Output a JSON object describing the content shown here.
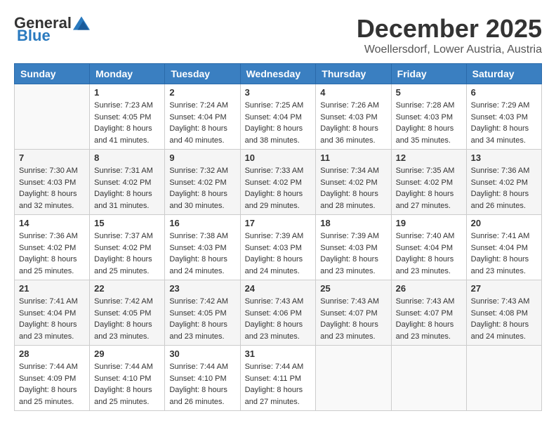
{
  "logo": {
    "general": "General",
    "blue": "Blue"
  },
  "title": "December 2025",
  "location": "Woellersdorf, Lower Austria, Austria",
  "days_of_week": [
    "Sunday",
    "Monday",
    "Tuesday",
    "Wednesday",
    "Thursday",
    "Friday",
    "Saturday"
  ],
  "weeks": [
    [
      {
        "day": "",
        "sunrise": "",
        "sunset": "",
        "daylight": ""
      },
      {
        "day": "1",
        "sunrise": "Sunrise: 7:23 AM",
        "sunset": "Sunset: 4:05 PM",
        "daylight": "Daylight: 8 hours and 41 minutes."
      },
      {
        "day": "2",
        "sunrise": "Sunrise: 7:24 AM",
        "sunset": "Sunset: 4:04 PM",
        "daylight": "Daylight: 8 hours and 40 minutes."
      },
      {
        "day": "3",
        "sunrise": "Sunrise: 7:25 AM",
        "sunset": "Sunset: 4:04 PM",
        "daylight": "Daylight: 8 hours and 38 minutes."
      },
      {
        "day": "4",
        "sunrise": "Sunrise: 7:26 AM",
        "sunset": "Sunset: 4:03 PM",
        "daylight": "Daylight: 8 hours and 36 minutes."
      },
      {
        "day": "5",
        "sunrise": "Sunrise: 7:28 AM",
        "sunset": "Sunset: 4:03 PM",
        "daylight": "Daylight: 8 hours and 35 minutes."
      },
      {
        "day": "6",
        "sunrise": "Sunrise: 7:29 AM",
        "sunset": "Sunset: 4:03 PM",
        "daylight": "Daylight: 8 hours and 34 minutes."
      }
    ],
    [
      {
        "day": "7",
        "sunrise": "Sunrise: 7:30 AM",
        "sunset": "Sunset: 4:03 PM",
        "daylight": "Daylight: 8 hours and 32 minutes."
      },
      {
        "day": "8",
        "sunrise": "Sunrise: 7:31 AM",
        "sunset": "Sunset: 4:02 PM",
        "daylight": "Daylight: 8 hours and 31 minutes."
      },
      {
        "day": "9",
        "sunrise": "Sunrise: 7:32 AM",
        "sunset": "Sunset: 4:02 PM",
        "daylight": "Daylight: 8 hours and 30 minutes."
      },
      {
        "day": "10",
        "sunrise": "Sunrise: 7:33 AM",
        "sunset": "Sunset: 4:02 PM",
        "daylight": "Daylight: 8 hours and 29 minutes."
      },
      {
        "day": "11",
        "sunrise": "Sunrise: 7:34 AM",
        "sunset": "Sunset: 4:02 PM",
        "daylight": "Daylight: 8 hours and 28 minutes."
      },
      {
        "day": "12",
        "sunrise": "Sunrise: 7:35 AM",
        "sunset": "Sunset: 4:02 PM",
        "daylight": "Daylight: 8 hours and 27 minutes."
      },
      {
        "day": "13",
        "sunrise": "Sunrise: 7:36 AM",
        "sunset": "Sunset: 4:02 PM",
        "daylight": "Daylight: 8 hours and 26 minutes."
      }
    ],
    [
      {
        "day": "14",
        "sunrise": "Sunrise: 7:36 AM",
        "sunset": "Sunset: 4:02 PM",
        "daylight": "Daylight: 8 hours and 25 minutes."
      },
      {
        "day": "15",
        "sunrise": "Sunrise: 7:37 AM",
        "sunset": "Sunset: 4:02 PM",
        "daylight": "Daylight: 8 hours and 25 minutes."
      },
      {
        "day": "16",
        "sunrise": "Sunrise: 7:38 AM",
        "sunset": "Sunset: 4:03 PM",
        "daylight": "Daylight: 8 hours and 24 minutes."
      },
      {
        "day": "17",
        "sunrise": "Sunrise: 7:39 AM",
        "sunset": "Sunset: 4:03 PM",
        "daylight": "Daylight: 8 hours and 24 minutes."
      },
      {
        "day": "18",
        "sunrise": "Sunrise: 7:39 AM",
        "sunset": "Sunset: 4:03 PM",
        "daylight": "Daylight: 8 hours and 23 minutes."
      },
      {
        "day": "19",
        "sunrise": "Sunrise: 7:40 AM",
        "sunset": "Sunset: 4:04 PM",
        "daylight": "Daylight: 8 hours and 23 minutes."
      },
      {
        "day": "20",
        "sunrise": "Sunrise: 7:41 AM",
        "sunset": "Sunset: 4:04 PM",
        "daylight": "Daylight: 8 hours and 23 minutes."
      }
    ],
    [
      {
        "day": "21",
        "sunrise": "Sunrise: 7:41 AM",
        "sunset": "Sunset: 4:04 PM",
        "daylight": "Daylight: 8 hours and 23 minutes."
      },
      {
        "day": "22",
        "sunrise": "Sunrise: 7:42 AM",
        "sunset": "Sunset: 4:05 PM",
        "daylight": "Daylight: 8 hours and 23 minutes."
      },
      {
        "day": "23",
        "sunrise": "Sunrise: 7:42 AM",
        "sunset": "Sunset: 4:05 PM",
        "daylight": "Daylight: 8 hours and 23 minutes."
      },
      {
        "day": "24",
        "sunrise": "Sunrise: 7:43 AM",
        "sunset": "Sunset: 4:06 PM",
        "daylight": "Daylight: 8 hours and 23 minutes."
      },
      {
        "day": "25",
        "sunrise": "Sunrise: 7:43 AM",
        "sunset": "Sunset: 4:07 PM",
        "daylight": "Daylight: 8 hours and 23 minutes."
      },
      {
        "day": "26",
        "sunrise": "Sunrise: 7:43 AM",
        "sunset": "Sunset: 4:07 PM",
        "daylight": "Daylight: 8 hours and 23 minutes."
      },
      {
        "day": "27",
        "sunrise": "Sunrise: 7:43 AM",
        "sunset": "Sunset: 4:08 PM",
        "daylight": "Daylight: 8 hours and 24 minutes."
      }
    ],
    [
      {
        "day": "28",
        "sunrise": "Sunrise: 7:44 AM",
        "sunset": "Sunset: 4:09 PM",
        "daylight": "Daylight: 8 hours and 25 minutes."
      },
      {
        "day": "29",
        "sunrise": "Sunrise: 7:44 AM",
        "sunset": "Sunset: 4:10 PM",
        "daylight": "Daylight: 8 hours and 25 minutes."
      },
      {
        "day": "30",
        "sunrise": "Sunrise: 7:44 AM",
        "sunset": "Sunset: 4:10 PM",
        "daylight": "Daylight: 8 hours and 26 minutes."
      },
      {
        "day": "31",
        "sunrise": "Sunrise: 7:44 AM",
        "sunset": "Sunset: 4:11 PM",
        "daylight": "Daylight: 8 hours and 27 minutes."
      },
      {
        "day": "",
        "sunrise": "",
        "sunset": "",
        "daylight": ""
      },
      {
        "day": "",
        "sunrise": "",
        "sunset": "",
        "daylight": ""
      },
      {
        "day": "",
        "sunrise": "",
        "sunset": "",
        "daylight": ""
      }
    ]
  ]
}
